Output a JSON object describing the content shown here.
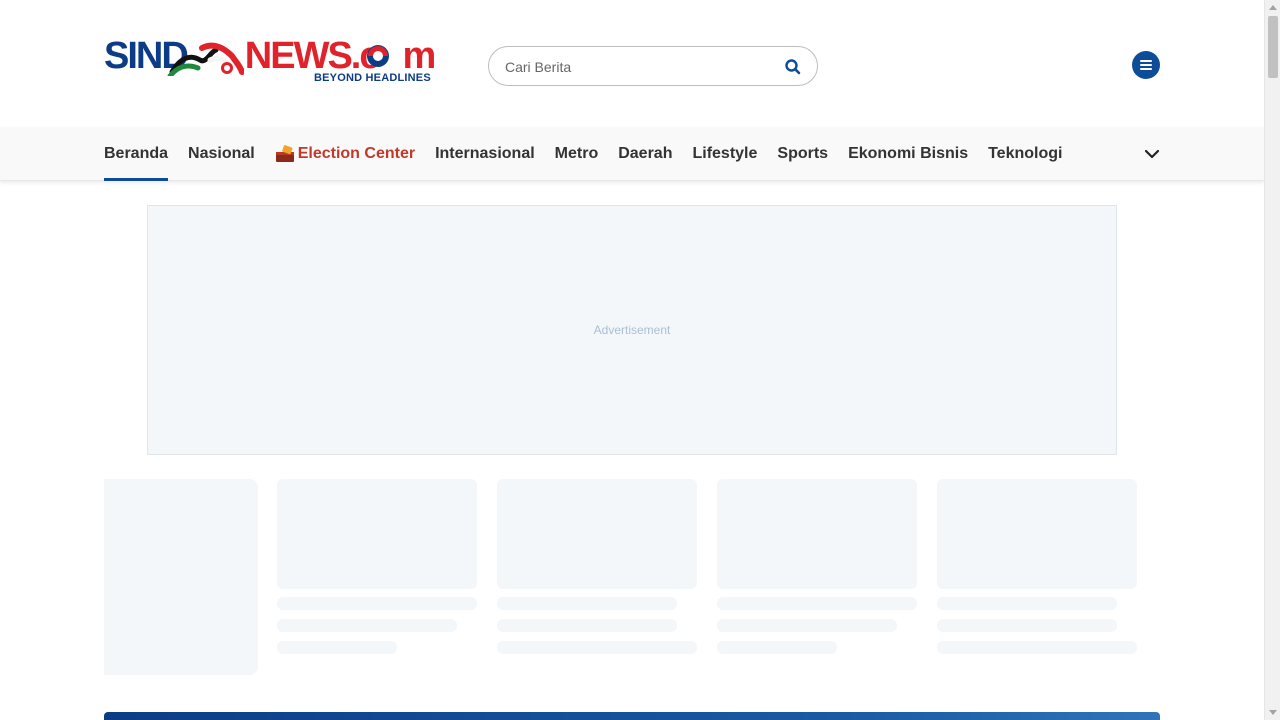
{
  "header": {
    "logo": {
      "part1": "SIND",
      "part2": "NEWS.c",
      "part3": "m",
      "tagline": "BEYOND HEADLINES"
    },
    "search": {
      "placeholder": "Cari Berita",
      "icon": "search-icon"
    },
    "menu_icon": "hamburger-menu-icon"
  },
  "nav": {
    "items": [
      {
        "label": "Beranda",
        "active": true
      },
      {
        "label": "Nasional"
      },
      {
        "label": "Election Center",
        "icon": "ballot-box-icon",
        "accent": "#c0392b"
      },
      {
        "label": "Internasional"
      },
      {
        "label": "Metro"
      },
      {
        "label": "Daerah"
      },
      {
        "label": "Lifestyle"
      },
      {
        "label": "Sports"
      },
      {
        "label": "Ekonomi Bisnis"
      },
      {
        "label": "Teknologi"
      }
    ],
    "more_icon": "chevron-down-icon"
  },
  "ad": {
    "label": "Advertisement"
  },
  "colors": {
    "brand_blue": "#0d3c86",
    "brand_red": "#e0232b",
    "accent_blue": "#0d4d97",
    "skeleton": "#f4f7fa"
  }
}
